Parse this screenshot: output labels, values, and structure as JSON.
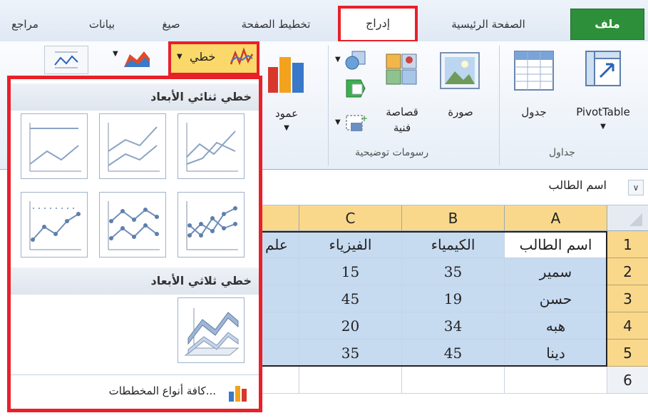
{
  "tabs": {
    "file": "ملف",
    "home": "الصفحة الرئيسية",
    "insert": "إدراج",
    "page_layout": "تخطيط الصفحة",
    "formulas": "صيغ",
    "data": "بيانات",
    "review": "مراجع"
  },
  "ribbon": {
    "pivottable": "PivotTable",
    "table": "جدول",
    "picture": "صورة",
    "clipart_line1": "قصاصة",
    "clipart_line2": "فنية",
    "column": "عمود",
    "line": "خطي",
    "group_tables": "جداول",
    "group_illustrations": "رسومات توضيحية"
  },
  "formula_bar": {
    "value": "اسم الطالب"
  },
  "grid": {
    "columns": [
      "A",
      "B",
      "C"
    ],
    "rows": [
      "1",
      "2",
      "3",
      "4",
      "5",
      "6"
    ],
    "headers": [
      "اسم الطالب",
      "الكيمياء",
      "الفيزياء",
      "علم"
    ],
    "data": [
      [
        "سمير",
        "35",
        "15"
      ],
      [
        "حسن",
        "19",
        "45"
      ],
      [
        "هبه",
        "34",
        "20"
      ],
      [
        "دينا",
        "45",
        "35"
      ]
    ]
  },
  "panel": {
    "header_2d": "خطي ثنائي الأبعاد",
    "header_3d": "خطي ثلاثي الأبعاد",
    "all_charts": "كافة أنواع المخططات..."
  },
  "colors": {
    "accent_red": "#e8202a",
    "file_green": "#2d8f3a",
    "selection_blue": "#c6daf0",
    "header_orange": "#f9d88c"
  }
}
